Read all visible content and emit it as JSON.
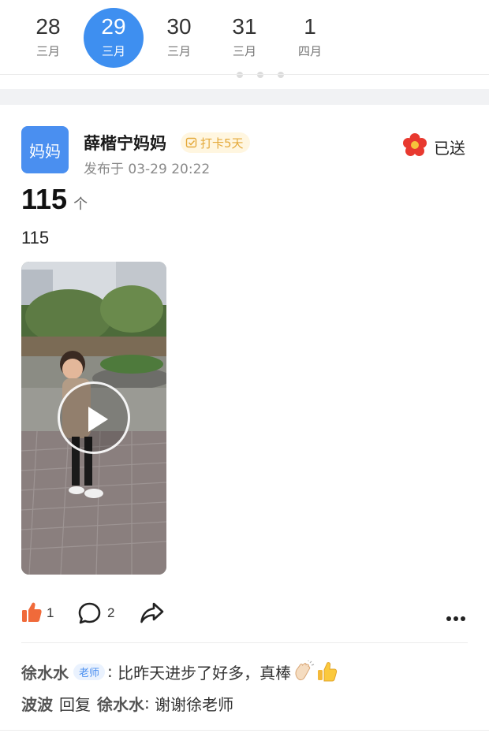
{
  "date_strip": {
    "dates": [
      {
        "day": "28",
        "month": "三月",
        "selected": false
      },
      {
        "day": "29",
        "month": "三月",
        "selected": true
      },
      {
        "day": "30",
        "month": "三月",
        "selected": false
      },
      {
        "day": "31",
        "month": "三月",
        "selected": false
      },
      {
        "day": "1",
        "month": "四月",
        "selected": false
      }
    ],
    "accent_color": "#3e8ff0"
  },
  "post": {
    "avatar_text": "妈妈",
    "author_name": "薛楷宁妈妈",
    "checkin_badge": "打卡5天",
    "publish_time": "发布于 03-29 20:22",
    "sent_label": "已送",
    "count_value": "115",
    "count_unit": "个",
    "text": "115",
    "video": {
      "icon": "play-icon"
    },
    "actions": {
      "like_count": "1",
      "comment_count": "2",
      "icons": [
        "thumbs-up-icon",
        "comment-icon",
        "share-icon",
        "more-icon"
      ]
    }
  },
  "comments": [
    {
      "author": "徐水水",
      "tag": "老师",
      "text": "比昨天进步了好多，真棒",
      "emojis": [
        "clap-emoji",
        "thumbs-up-emoji"
      ]
    },
    {
      "author": "波波",
      "reply_word": "回复",
      "reply_to": "徐水水",
      "text": "谢谢徐老师"
    }
  ],
  "colors": {
    "badge_text": "#e4a93a",
    "teacher_tag": "#4a8ff0",
    "like": "#f06a3a"
  }
}
